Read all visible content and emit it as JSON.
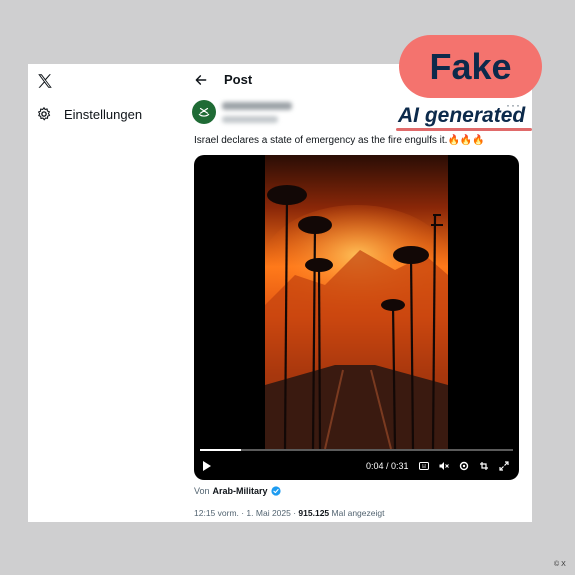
{
  "sidebar": {
    "logo_icon": "x-logo-icon",
    "settings_label": "Einstellungen"
  },
  "post": {
    "header_title": "Post",
    "text": "Israel declares a state of emergency as the fire engulfs it.",
    "emojis": "🔥🔥🔥",
    "video": {
      "current_time": "0:04",
      "duration": "0:31",
      "time_display": "0:04 / 0:31",
      "progress": 0.13
    },
    "byline_prefix": "Von",
    "byline_author": "Arab-Military",
    "timestamp": "12:15 vorm. · 1. Mai 2025 ·",
    "view_count": "915.125",
    "views_label": "Mal angezeigt"
  },
  "overlay": {
    "fake_label": "Fake",
    "ai_label": "AI generated",
    "credit": "© X"
  },
  "colors": {
    "badge_bg": "#f4736e",
    "badge_text": "#0c2a4b",
    "underline": "#e06a6a"
  }
}
